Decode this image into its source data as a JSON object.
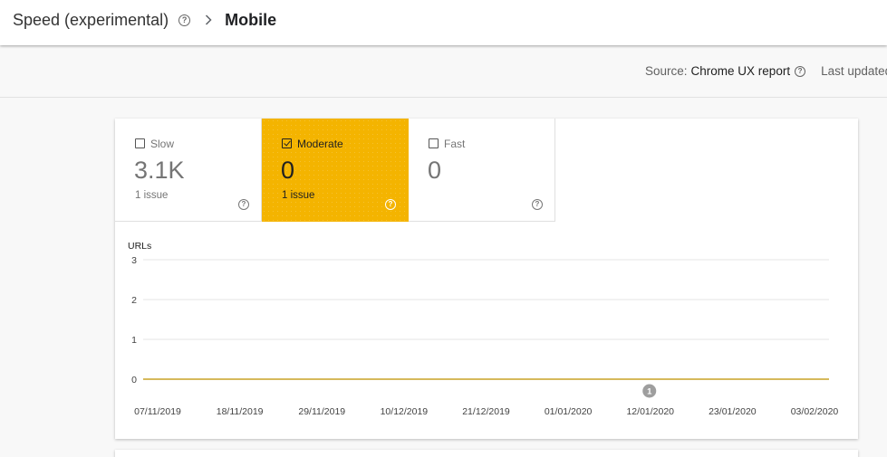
{
  "header": {
    "parent": "Speed (experimental)",
    "separator": ">",
    "current": "Mobile"
  },
  "source_bar": {
    "source_label": "Source:",
    "source_value": "Chrome UX report",
    "last_updated_label": "Last updated"
  },
  "tiles": [
    {
      "label": "Slow",
      "value": "3.1K",
      "sub": "1 issue",
      "checked": false
    },
    {
      "label": "Moderate",
      "value": "0",
      "sub": "1 issue",
      "checked": true
    },
    {
      "label": "Fast",
      "value": "0",
      "sub": "",
      "checked": false
    }
  ],
  "icons": {
    "help": "help-circle-icon",
    "separator": "chevron-right-icon",
    "checkbox": "checkbox-icon",
    "annotation": "annotation-marker-icon"
  },
  "colors": {
    "accent_moderate": "#f4b400",
    "series_line": "#c9a227",
    "grid": "#e6e6e6",
    "annotation_marker": "#9e9e9e"
  },
  "chart_data": {
    "type": "line",
    "ylabel": "URLs",
    "ylim": [
      0,
      3
    ],
    "yticks": [
      "0",
      "1",
      "2",
      "3"
    ],
    "xticks": [
      "07/11/2019",
      "18/11/2019",
      "29/11/2019",
      "10/12/2019",
      "21/12/2019",
      "01/01/2020",
      "12/01/2020",
      "23/01/2020",
      "03/02/2020"
    ],
    "x_start": "07/11/2019",
    "x_end": "03/02/2020",
    "grid": true,
    "series": [
      {
        "values": [
          0,
          0,
          0,
          0,
          0,
          0,
          0,
          0,
          0
        ],
        "color": "#c9a227"
      }
    ],
    "annotations": [
      {
        "label": "1",
        "x": "12/01/2020"
      }
    ]
  }
}
